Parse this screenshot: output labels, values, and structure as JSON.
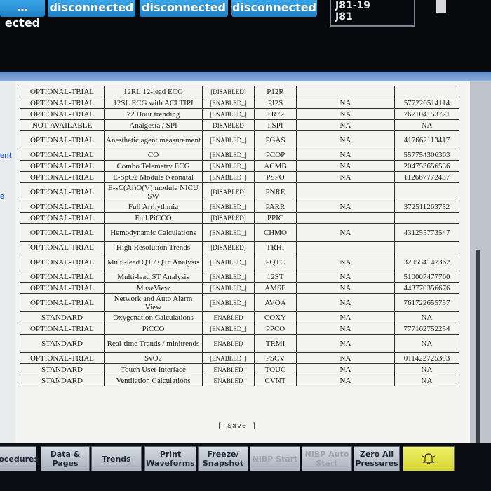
{
  "header": {
    "status_buttons": [
      "…ected",
      "disconnected",
      "disconnected",
      "disconnected"
    ],
    "bed": [
      "J81-19",
      "J81"
    ]
  },
  "left_fragments": [
    "ent",
    "e"
  ],
  "options_table": {
    "rows": [
      {
        "license": "OPTIONAL-TRIAL",
        "name": "12RL 12-lead ECG",
        "status": "[DISABLED]",
        "code": "P12R",
        "col5": "",
        "col6": ""
      },
      {
        "license": "OPTIONAL-TRIAL",
        "name": "12SL ECG with ACI TIPI",
        "status": "[ENABLED_]",
        "code": "PI2S",
        "col5": "NA",
        "col6": "577226514114"
      },
      {
        "license": "OPTIONAL-TRIAL",
        "name": "72 Hour trending",
        "status": "[ENABLED_]",
        "code": "TR72",
        "col5": "NA",
        "col6": "767104153721"
      },
      {
        "license": "NOT-AVAILABLE",
        "name": "Analgesia / SPI",
        "status": "DISABLED",
        "code": "PSPI",
        "col5": "NA",
        "col6": "NA"
      },
      {
        "license": "OPTIONAL-TRIAL",
        "name": "Anesthetic agent measurement",
        "status": "[ENABLED_]",
        "code": "PGAS",
        "col5": "NA",
        "col6": "417662113417"
      },
      {
        "license": "OPTIONAL-TRIAL",
        "name": "CO",
        "status": "[ENABLED_]",
        "code": "PCOP",
        "col5": "NA",
        "col6": "557754306363"
      },
      {
        "license": "OPTIONAL-TRIAL",
        "name": "Combo Telemetry ECG",
        "status": "[ENABLED_]",
        "code": "ACMB",
        "col5": "NA",
        "col6": "204753656536"
      },
      {
        "license": "OPTIONAL-TRIAL",
        "name": "E-SpO2 Module Neonatal",
        "status": "[ENABLED_]",
        "code": "PSPO",
        "col5": "NA",
        "col6": "112667772437"
      },
      {
        "license": "OPTIONAL-TRIAL",
        "name": "E-sC(Ai)O(V) module NICU SW",
        "status": "[DISABLED]",
        "code": "PNRE",
        "col5": "",
        "col6": ""
      },
      {
        "license": "OPTIONAL-TRIAL",
        "name": "Full Arrhythmia",
        "status": "[ENABLED_]",
        "code": "PARR",
        "col5": "NA",
        "col6": "372511263752"
      },
      {
        "license": "OPTIONAL-TRIAL",
        "name": "Full PiCCO",
        "status": "[DISABLED]",
        "code": "PPIC",
        "col5": "",
        "col6": ""
      },
      {
        "license": "OPTIONAL-TRIAL",
        "name": "Hemodynamic Calculations",
        "status": "[ENABLED_]",
        "code": "CHMO",
        "col5": "NA",
        "col6": "431255773547"
      },
      {
        "license": "OPTIONAL-TRIAL",
        "name": "High Resolution Trends",
        "status": "[DISABLED]",
        "code": "TRHI",
        "col5": "",
        "col6": ""
      },
      {
        "license": "OPTIONAL-TRIAL",
        "name": "Multi-lead QT / QTc Analysis",
        "status": "[ENABLED_]",
        "code": "PQTC",
        "col5": "NA",
        "col6": "320554147362"
      },
      {
        "license": "OPTIONAL-TRIAL",
        "name": "Multi-lead ST Analysis",
        "status": "[ENABLED_]",
        "code": "12ST",
        "col5": "NA",
        "col6": "510007477760"
      },
      {
        "license": "OPTIONAL-TRIAL",
        "name": "MuseView",
        "status": "[ENABLED_]",
        "code": "AMSE",
        "col5": "NA",
        "col6": "443770356676"
      },
      {
        "license": "OPTIONAL-TRIAL",
        "name": "Network and Auto Alarm View",
        "status": "[ENABLED_]",
        "code": "AVOA",
        "col5": "NA",
        "col6": "761722655757"
      },
      {
        "license": "STANDARD",
        "name": "Oxygenation Calculations",
        "status": "ENABLED",
        "code": "COXY",
        "col5": "NA",
        "col6": "NA"
      },
      {
        "license": "OPTIONAL-TRIAL",
        "name": "PiCCO",
        "status": "[ENABLED_]",
        "code": "PPCO",
        "col5": "NA",
        "col6": "777162752254"
      },
      {
        "license": "STANDARD",
        "name": "Real-time Trends / minitrends",
        "status": "ENABLED",
        "code": "TRMI",
        "col5": "NA",
        "col6": "NA"
      },
      {
        "license": "OPTIONAL-TRIAL",
        "name": "SvO2",
        "status": "[ENABLED_]",
        "code": "PSCV",
        "col5": "NA",
        "col6": "011422725303"
      },
      {
        "license": "STANDARD",
        "name": "Touch User Interface",
        "status": "ENABLED",
        "code": "TOUC",
        "col5": "NA",
        "col6": "NA"
      },
      {
        "license": "STANDARD",
        "name": "Ventilation Calculations",
        "status": "ENABLED",
        "code": "CVNT",
        "col5": "NA",
        "col6": "NA"
      }
    ]
  },
  "save_label": "[ Save ]",
  "softkeys": [
    {
      "label": "rocedures",
      "disabled": false
    },
    {
      "label": "Data & Pages",
      "disabled": false
    },
    {
      "label": "Trends",
      "disabled": false
    },
    {
      "label": "Print Waveforms",
      "disabled": false
    },
    {
      "label": "Freeze/ Snapshot",
      "disabled": false
    },
    {
      "label": "NIBP Start",
      "disabled": true
    },
    {
      "label": "NIBP Auto Start",
      "disabled": true
    },
    {
      "label": "Zero All Pressures",
      "disabled": false
    }
  ],
  "alarm_icon": "alarm-bell-icon",
  "colors": {
    "status_button": "#2a92d8",
    "panel_title": "#6f98d0",
    "alarm_key": "#e8e84a"
  }
}
